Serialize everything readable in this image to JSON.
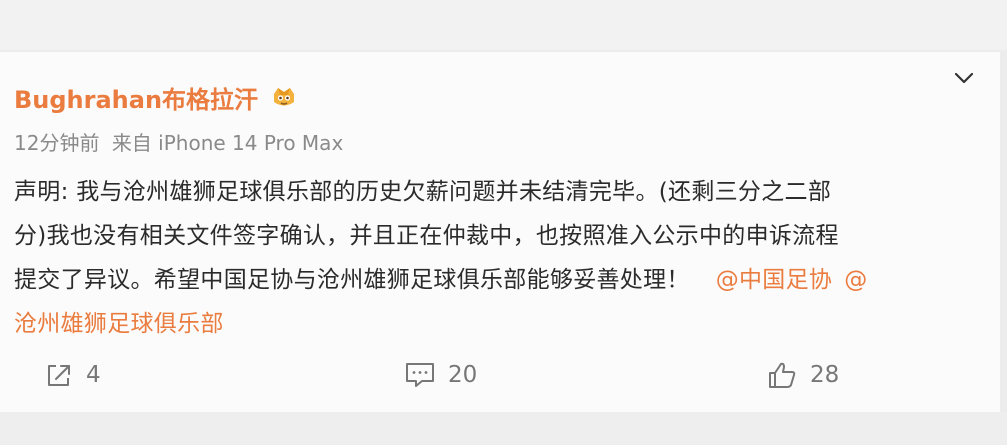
{
  "post": {
    "username": "Bughrahan布格拉汗",
    "time": "12分钟前",
    "source": "来自 iPhone 14 Pro Max",
    "content_lines": [
      "声明: 我与沧州雄狮足球俱乐部的历史欠薪问题并未结清完毕。(还剩三分之二部",
      "分)我也没有相关文件签字确认，并且正在仲裁中，也按照准入公示中的申诉流程",
      "提交了异议。希望中国足协与沧州雄狮足球俱乐部能够妥善处理！"
    ],
    "mention1": "@中国足协",
    "mention2": "@",
    "mention2_rest": "沧州雄狮足球俱乐部",
    "icons": {
      "badge": "vip-badge-icon",
      "menu": "chevron-down-icon",
      "repost": "share-icon",
      "comment": "comment-icon",
      "like": "thumbs-up-icon"
    },
    "colors": {
      "accent": "#ea7c3f",
      "text": "#2b2b2b",
      "meta": "#8a8a8a",
      "icon": "#777777"
    }
  },
  "actions": {
    "repost_count": "4",
    "comment_count": "20",
    "like_count": "28"
  }
}
